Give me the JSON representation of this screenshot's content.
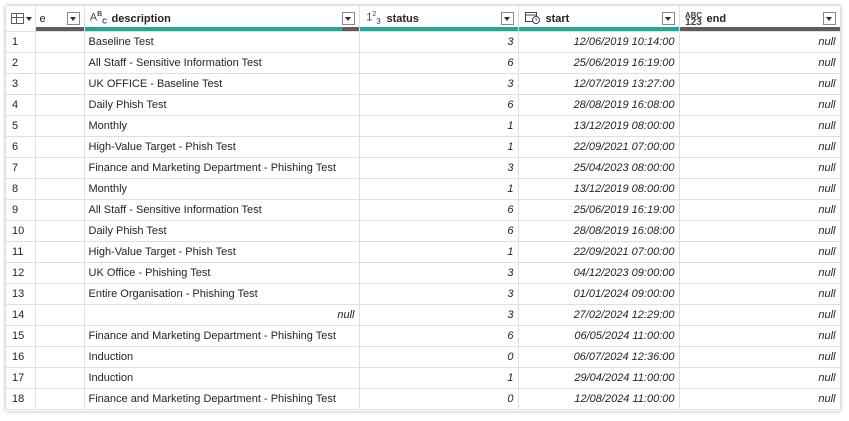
{
  "columns": [
    {
      "name": "e",
      "type_icon": ""
    },
    {
      "name": "description",
      "type_icon": "A B C"
    },
    {
      "name": "status",
      "type_icon": "1 2 3"
    },
    {
      "name": "start",
      "type_icon": "datetime-icon"
    },
    {
      "name": "end",
      "type_icon": "ABC 123"
    }
  ],
  "rows": [
    {
      "n": "1",
      "e": "",
      "description": "Baseline Test",
      "status": "3",
      "start": "12/06/2019 10:14:00",
      "end": "null"
    },
    {
      "n": "2",
      "e": "",
      "description": "All Staff - Sensitive Information Test",
      "status": "6",
      "start": "25/06/2019 16:19:00",
      "end": "null"
    },
    {
      "n": "3",
      "e": "",
      "description": "UK OFFICE - Baseline Test",
      "status": "3",
      "start": "12/07/2019 13:27:00",
      "end": "null"
    },
    {
      "n": "4",
      "e": "",
      "description": "Daily Phish Test",
      "status": "6",
      "start": "28/08/2019 16:08:00",
      "end": "null"
    },
    {
      "n": "5",
      "e": "",
      "description": "Monthly",
      "status": "1",
      "start": "13/12/2019 08:00:00",
      "end": "null"
    },
    {
      "n": "6",
      "e": "",
      "description": "High-Value Target - Phish Test",
      "status": "1",
      "start": "22/09/2021 07:00:00",
      "end": "null"
    },
    {
      "n": "7",
      "e": "",
      "description": "Finance and Marketing Department - Phishing Test",
      "status": "3",
      "start": "25/04/2023 08:00:00",
      "end": "null"
    },
    {
      "n": "8",
      "e": "",
      "description": "Monthly",
      "status": "1",
      "start": "13/12/2019 08:00:00",
      "end": "null"
    },
    {
      "n": "9",
      "e": "",
      "description": "All Staff - Sensitive Information Test",
      "status": "6",
      "start": "25/06/2019 16:19:00",
      "end": "null"
    },
    {
      "n": "10",
      "e": "",
      "description": "Daily Phish Test",
      "status": "6",
      "start": "28/08/2019 16:08:00",
      "end": "null"
    },
    {
      "n": "11",
      "e": "",
      "description": "High-Value Target - Phish Test",
      "status": "1",
      "start": "22/09/2021 07:00:00",
      "end": "null"
    },
    {
      "n": "12",
      "e": "",
      "description": "UK Office - Phishing Test",
      "status": "3",
      "start": "04/12/2023 09:00:00",
      "end": "null"
    },
    {
      "n": "13",
      "e": "",
      "description": "Entire Organisation - Phishing Test",
      "status": "3",
      "start": "01/01/2024 09:00:00",
      "end": "null"
    },
    {
      "n": "14",
      "e": "",
      "description": "null",
      "status": "3",
      "start": "27/02/2024 12:29:00",
      "end": "null"
    },
    {
      "n": "15",
      "e": "",
      "description": "Finance and Marketing Department - Phishing Test",
      "status": "6",
      "start": "06/05/2024 11:00:00",
      "end": "null"
    },
    {
      "n": "16",
      "e": "",
      "description": "Induction",
      "status": "0",
      "start": "06/07/2024 12:36:00",
      "end": "null"
    },
    {
      "n": "17",
      "e": "",
      "description": "Induction",
      "status": "1",
      "start": "29/04/2024 11:00:00",
      "end": "null"
    },
    {
      "n": "18",
      "e": "",
      "description": "Finance and Marketing Department - Phishing Test",
      "status": "0",
      "start": "12/08/2024 11:00:00",
      "end": "null"
    }
  ],
  "colors": {
    "quality_valid": "#1aab9b",
    "quality_empty": "#605e5c"
  }
}
